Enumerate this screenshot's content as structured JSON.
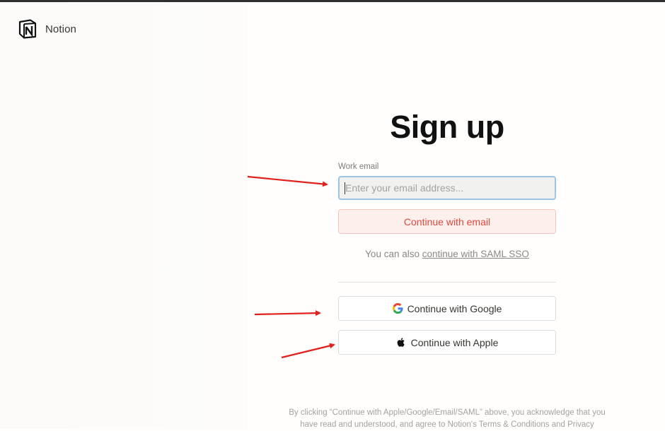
{
  "app": {
    "name": "Notion"
  },
  "page": {
    "title": "Sign up"
  },
  "form": {
    "email_label": "Work email",
    "email_placeholder": "Enter your email address...",
    "email_value": "",
    "continue_email_label": "Continue with email"
  },
  "sso": {
    "prefix": "You can also ",
    "link": "continue with SAML SSO"
  },
  "social": {
    "google_label": "Continue with Google",
    "apple_label": "Continue with Apple"
  },
  "legal": {
    "line1": "By clicking “Continue with Apple/Google/Email/SAML” above, you acknowledge that you",
    "line2": "have read and understood, and agree to Notion's Terms & Conditions and Privacy"
  },
  "colors": {
    "annotation_arrow": "#e0201a",
    "accent_red": "#e0473e",
    "focus_border": "#9cc4e6"
  },
  "icons": [
    "notion-logo-icon",
    "google-icon",
    "apple-icon"
  ]
}
